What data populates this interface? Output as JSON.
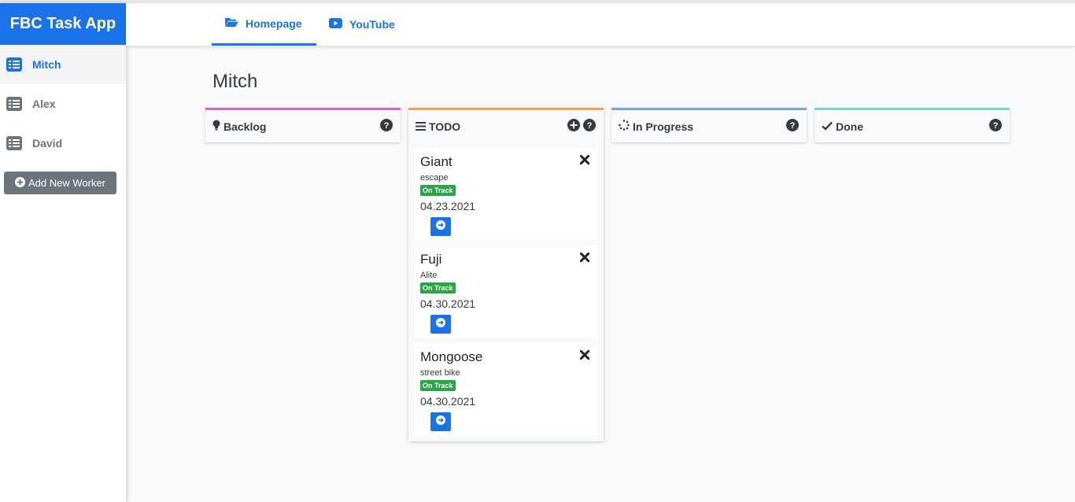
{
  "app": {
    "title": "FBC Task App"
  },
  "sidebar": {
    "workers": [
      {
        "name": "Mitch",
        "active": true
      },
      {
        "name": "Alex",
        "active": false
      },
      {
        "name": "David",
        "active": false
      }
    ],
    "add_label": "Add New Worker"
  },
  "nav": {
    "tabs": [
      {
        "label": "Homepage",
        "icon": "folder-open-icon",
        "active": true
      },
      {
        "label": "YouTube",
        "icon": "youtube-icon",
        "active": false
      }
    ]
  },
  "board": {
    "worker_name": "Mitch",
    "columns": [
      {
        "title": "Backlog",
        "icon": "lightbulb-icon",
        "color": "#d36cb8"
      },
      {
        "title": "TODO",
        "icon": "bars-icon",
        "color": "#f0a05a"
      },
      {
        "title": "In Progress",
        "icon": "spinner-icon",
        "color": "#7aa1e6"
      },
      {
        "title": "Done",
        "icon": "check-icon",
        "color": "#7fd3c5"
      }
    ],
    "todo_cards": [
      {
        "title": "Giant",
        "subtitle": "escape",
        "status": "On Track",
        "date": "04.23.2021"
      },
      {
        "title": "Fuji",
        "subtitle": "Alite",
        "status": "On Track",
        "date": "04.30.2021"
      },
      {
        "title": "Mongoose",
        "subtitle": "street bike",
        "status": "On Track",
        "date": "04.30.2021"
      }
    ]
  },
  "colors": {
    "primary": "#1a73e8",
    "success": "#28a745",
    "secondary": "#6c757d"
  }
}
